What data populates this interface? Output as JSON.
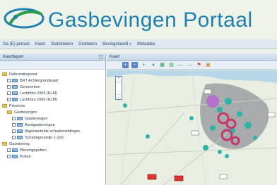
{
  "header": {
    "title": "Gasbevingen Portaal",
    "logo_icon": "logo-icon"
  },
  "menu": [
    "Ga (E) portaal",
    "Kaart",
    "Statistieken",
    "Grafieken",
    "Bevingsbeeld »",
    "Metadata"
  ],
  "left_panel": {
    "title": "Kaartlagen",
    "tree": [
      {
        "label": "Referentiegrond",
        "level": 0,
        "type": "folder"
      },
      {
        "label": "BRT Achtergrondkaart",
        "level": 1,
        "type": "layer"
      },
      {
        "label": "Gemeenten",
        "level": 1,
        "type": "layer"
      },
      {
        "label": "Luchtfoto 2009 (KLM)",
        "level": 1,
        "type": "layer"
      },
      {
        "label": "Luchtfoto 2006 (KLM)",
        "level": 1,
        "type": "layer"
      },
      {
        "label": "Provincie",
        "level": 0,
        "type": "folder"
      },
      {
        "label": "Gasbevingen",
        "level": 1,
        "type": "folder"
      },
      {
        "label": "Gasbevingen",
        "level": 2,
        "type": "layer"
      },
      {
        "label": "Aardgasbevingen",
        "level": 2,
        "type": "layer"
      },
      {
        "label": "Afgehandelde schademeldingen",
        "level": 2,
        "type": "layer"
      },
      {
        "label": "Schadegrenslijn 1-100",
        "level": 2,
        "type": "layer"
      },
      {
        "label": "Gaswinning",
        "level": 0,
        "type": "folder"
      },
      {
        "label": "Winningsputten",
        "level": 1,
        "type": "layer"
      },
      {
        "label": "Putten",
        "level": 1,
        "type": "layer"
      }
    ]
  },
  "map_panel": {
    "title": "Kaart"
  },
  "toolbar": [
    "zoom-in-icon",
    "zoom-out-icon",
    "add-icon",
    "previous-icon",
    "grid-icon",
    "layers-icon",
    "line-icon",
    "measure-icon",
    "flag-icon",
    "export-icon"
  ],
  "map": {
    "zoom_controls": [
      "+",
      "−"
    ],
    "road_signs": [
      "N33",
      "N46",
      "N360",
      "N361",
      "N46",
      "A7"
    ],
    "colors": {
      "land": "#e9eee3",
      "sea": "#b7d7e8",
      "region": "#8a8f93",
      "quake": "#2fb3a8",
      "heavy": "#b66bd3",
      "rings": "#c4376b"
    }
  }
}
